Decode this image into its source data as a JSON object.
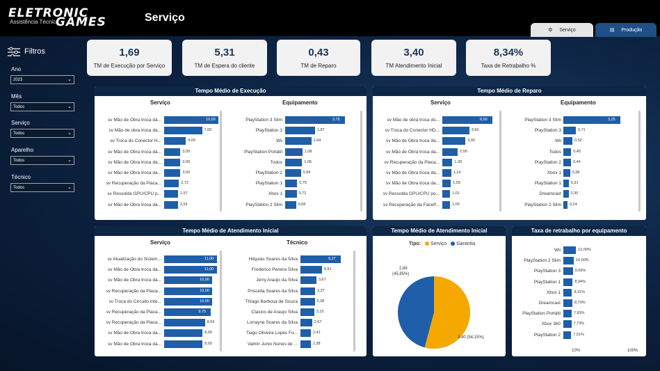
{
  "header": {
    "logo_line1": "ELETRONIC",
    "logo_line2": "Assistência Técnica",
    "logo_line3": "GAMES",
    "title": "Serviço",
    "tabs": [
      {
        "label": "Serviço"
      },
      {
        "label": "Produção"
      }
    ]
  },
  "filters": {
    "title": "Filtros",
    "items": [
      {
        "label": "Ano",
        "value": "2023"
      },
      {
        "label": "Mês",
        "value": "Todos"
      },
      {
        "label": "Serviço",
        "value": "Todos"
      },
      {
        "label": "Aparelho",
        "value": "Todos"
      },
      {
        "label": "Técnico",
        "value": "Todos"
      }
    ]
  },
  "kpis": [
    {
      "value": "1,69",
      "label": "TM de Execução por Serviço"
    },
    {
      "value": "5,31",
      "label": "TM de Espera do cliente"
    },
    {
      "value": "0,43",
      "label": "TM de Reparo"
    },
    {
      "value": "3,40",
      "label": "TM Atendimento Inicial"
    },
    {
      "value": "8,34%",
      "label": "Taxa de Retrabalho %"
    }
  ],
  "colors": {
    "bar": "#1f5ea8",
    "servico": "#f5a800",
    "garantia": "#1f5ea8",
    "panel_header": "#0d2646"
  },
  "chart_data": [
    {
      "type": "bar",
      "orientation": "horizontal",
      "title": "Tempo Médio de Execução",
      "subtitle": "Serviço",
      "categories": [
        "sv Mão de Obra troca da...",
        "sv Mão de obra troca da...",
        "sv Troca do Conector H...",
        "sv Mão de Obra troca da...",
        "sv Mão de Obra troca da...",
        "sv Mão de Obra troca da...",
        "sv Recuperação da Placa...",
        "sv Ressolda GPU/CPU p...",
        "sv Mão de Obra troca da..."
      ],
      "values": [
        10.0,
        7.0,
        4.0,
        3.0,
        3.0,
        3.0,
        2.72,
        2.57,
        2.55
      ],
      "labels": [
        "10,00",
        "7,00",
        "4,00",
        "3,00",
        "3,00",
        "3,00",
        "2,72",
        "2,57",
        "2,55"
      ],
      "xlim": [
        0,
        10
      ]
    },
    {
      "type": "bar",
      "orientation": "horizontal",
      "title": "Tempo Médio de Execução",
      "subtitle": "Equipamento",
      "categories": [
        "PlayStation 3 Slim",
        "PlayStation 3",
        "Wii",
        "PlayStation Portátil",
        "Todos",
        "PlayStation 2",
        "PlayStation 1",
        "Xbox 1",
        "PlayStation 2 Slim"
      ],
      "values": [
        3.75,
        1.87,
        1.64,
        1.08,
        1.06,
        0.99,
        0.75,
        0.72,
        0.68
      ],
      "labels": [
        "3,75",
        "1,87",
        "1,64",
        "1,08",
        "1,06",
        "0,99",
        "0,75",
        "0,72",
        "0,68"
      ],
      "xlim": [
        0,
        3.75
      ]
    },
    {
      "type": "bar",
      "orientation": "horizontal",
      "title": "Tempo Médio de Reparo",
      "subtitle": "Serviço",
      "categories": [
        "sv Mão de obra troca do...",
        "sv Troca do Conector HD...",
        "sv Mão de Obra troca da...",
        "sv Mão de Obra troca da...",
        "sv Recuperação da Placa...",
        "sv Mão de Obra troca da...",
        "sv Mão de Obra troca da...",
        "sv Ressolda GPU/CPU po...",
        "sv Recuperação da FaceP..."
      ],
      "values": [
        6.5,
        3.5,
        3.0,
        2.0,
        1.3,
        1.14,
        1.09,
        1.01,
        1.0
      ],
      "labels": [
        "6,50",
        "3,50",
        "3,00",
        "2,00",
        "1,30",
        "1,14",
        "1,09",
        "1,01",
        "1,00"
      ],
      "xlim": [
        0,
        6.5
      ]
    },
    {
      "type": "bar",
      "orientation": "horizontal",
      "title": "Tempo Médio de Reparo",
      "subtitle": "Equipamento",
      "categories": [
        "PlayStation 3 Slim",
        "PlayStation 3",
        "Wii",
        "Todos",
        "PlayStation 2",
        "Xbox 1",
        "PlayStation 1",
        "Dreamcast",
        "PlayStation 2 Slim"
      ],
      "values": [
        3.25,
        0.71,
        0.52,
        0.45,
        0.44,
        0.38,
        0.31,
        0.3,
        0.24
      ],
      "labels": [
        "3,25",
        "0,71",
        "0,52",
        "0,45",
        "0,44",
        "0,38",
        "0,31",
        "0,30",
        "0,24"
      ],
      "xlim": [
        0,
        3.25
      ]
    },
    {
      "type": "bar",
      "orientation": "horizontal",
      "title": "Tempo Médio de Atendimento Inicial",
      "subtitle": "Serviço",
      "categories": [
        "sv Atualização do Sistem...",
        "sv Mão de Obra troca da...",
        "sv Mão de Obra troca da...",
        "sv Recuperação da Placa...",
        "sv Troca do Circuito Inte...",
        "sv Recuperação da Placa...",
        "sv Recuperação da Placa...",
        "sv Mão de Obra troca da...",
        "sv Mão de Obra troca da..."
      ],
      "values": [
        11.0,
        11.0,
        10.0,
        10.0,
        10.0,
        9.75,
        8.5,
        8.0,
        8.0
      ],
      "labels": [
        "11,00",
        "11,00",
        "10,00",
        "10,00",
        "10,00",
        "9,75",
        "8,50",
        "8,00",
        "8,00"
      ],
      "xlim": [
        0,
        11
      ]
    },
    {
      "type": "bar",
      "orientation": "horizontal",
      "title": "Tempo Médio de Atendimento Inicial",
      "subtitle": "Técnico",
      "categories": [
        "Hilquias Soares da Silva",
        "Frederico Pereira Silva",
        "Jerry Araújo da Silva",
        "Priscella Soares da Silva",
        "Thiago Barbosa de Souza",
        "Clasios de Araujo Silva",
        "Lorrayne Soares da Silva",
        "Tiago Oliveira Lopes Fo...",
        "Valmir Junio Nunes de ..."
      ],
      "values": [
        9.27,
        4.91,
        3.67,
        3.37,
        3.28,
        3.15,
        2.67,
        2.41,
        2.38
      ],
      "labels": [
        "9,27",
        "4,91",
        "3,67",
        "3,37",
        "3,28",
        "3,15",
        "2,67",
        "2,41",
        "2,38"
      ],
      "xlim": [
        0,
        9.27
      ]
    },
    {
      "type": "pie",
      "title": "Tempo Médio de Atendimento Inicial",
      "legend_title": "Tipo:",
      "series": [
        {
          "name": "Serviço",
          "value": 3.4,
          "label": "3,40 (54,15%)"
        },
        {
          "name": "Garantia",
          "value": 2.88,
          "label": "2,88 (45,85%)"
        }
      ]
    },
    {
      "type": "bar",
      "orientation": "horizontal",
      "title": "Taxa de retrabalho por equipamento",
      "categories": [
        "Wii",
        "PlayStation 2 Slim",
        "PlayStation 3",
        "PlayStation 1",
        "Xbox 1",
        "Dreamcast",
        "PlayStation Portátil",
        "Xbox 360",
        "PlayStation 2"
      ],
      "values": [
        12.09,
        10.0,
        9.09,
        8.94,
        8.31,
        8.7,
        7.93,
        7.73,
        7.51
      ],
      "labels": [
        "12,09%",
        "10,00%",
        "9,09%",
        "8,94%",
        "8,31%",
        "8,70%",
        "7,93%",
        "7,73%",
        "7,51%"
      ],
      "xlim": [
        0,
        100
      ],
      "ticks": [
        "10%",
        "100%"
      ]
    }
  ]
}
